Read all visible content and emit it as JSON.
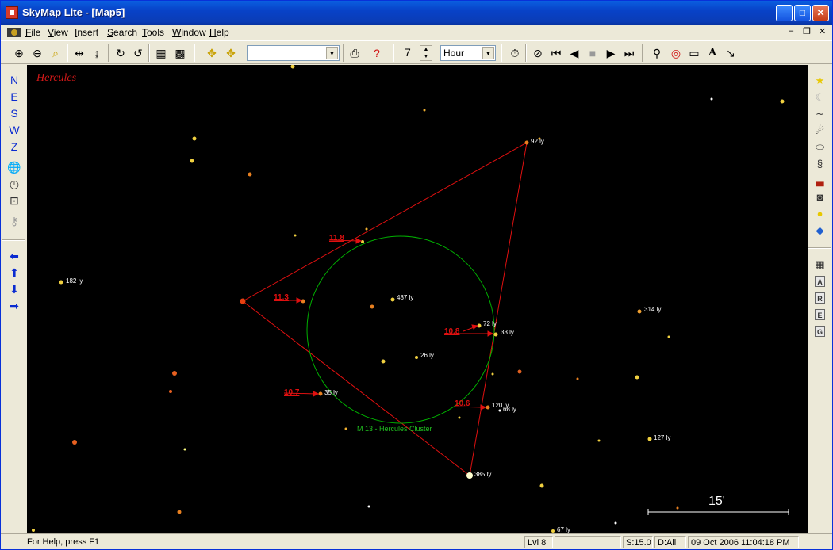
{
  "window": {
    "title": "SkyMap Lite - [Map5]"
  },
  "menu": [
    {
      "label": "File",
      "key": "F",
      "rest": "ile"
    },
    {
      "label": "View",
      "key": "V",
      "rest": "iew"
    },
    {
      "label": "Insert",
      "key": "I",
      "rest": "nsert"
    },
    {
      "label": "Search",
      "key": "S",
      "rest": "earch"
    },
    {
      "label": "Tools",
      "key": "T",
      "rest": "ools"
    },
    {
      "label": "Window",
      "key": "W",
      "rest": "indow"
    },
    {
      "label": "Help",
      "key": "H",
      "rest": "elp"
    }
  ],
  "toolbar": {
    "search_value": "",
    "step_value": "7",
    "step_unit": "Hour",
    "icons": [
      "zoom-in-icon",
      "zoom-out-icon",
      "zoom-window-icon",
      "flip-horizontal-icon",
      "flip-vertical-icon",
      "rotate-cw-icon",
      "rotate-ccw-icon",
      "grid-icon",
      "grid-alt-icon",
      "center-icon",
      "center-alt-icon",
      "print-icon",
      "whats-this-icon",
      "clock-icon",
      "animate-icon",
      "rewind-fast-icon",
      "step-back-icon",
      "stop-icon",
      "play-icon",
      "fast-forward-icon",
      "telescope-icon",
      "target-icon",
      "rectangle-icon",
      "text-icon",
      "arrow-icon"
    ]
  },
  "leftbar": {
    "directions": [
      "N",
      "E",
      "S",
      "W",
      "Z"
    ],
    "icons": [
      "globe-icon",
      "clock-icon",
      "zoom-icon",
      "key-icon",
      "pan-left-icon",
      "pan-up-icon",
      "pan-down-icon",
      "pan-right-icon"
    ]
  },
  "rightbar": {
    "icons": [
      "stars-icon",
      "moon-icon",
      "milky-way-icon",
      "comet-icon",
      "nebula-icon",
      "galaxy-icon",
      "horizon-icon",
      "camera-icon",
      "bulb-icon",
      "colors-icon",
      "table-icon"
    ],
    "letters": [
      "A",
      "R",
      "E",
      "G"
    ]
  },
  "map": {
    "constellation": "Hercules",
    "cluster_label": "M 13 - Hercules Cluster",
    "scale_label": "15'",
    "magnitude_labels": [
      "11.8",
      "11.3",
      "10.8",
      "10.7",
      "10.6"
    ],
    "distance_labels": [
      "92 ly",
      "182 ly",
      "487 ly",
      "314 ly",
      "72 ly",
      "33 ly",
      "26 ly",
      "35 ly",
      "120 ly",
      "68 ly",
      "127 ly",
      "385 ly",
      "67 ly"
    ],
    "colors": {
      "background": "#000000",
      "triangle": "#e01010",
      "circle": "#00b000",
      "label_red": "#e01010"
    }
  },
  "status": {
    "help": "For Help, press F1",
    "level": "Lvl 8",
    "blank": "",
    "scale": "S:15.0",
    "distance": "D:All",
    "datetime": "09 Oct 2006 11:04:18 PM"
  }
}
